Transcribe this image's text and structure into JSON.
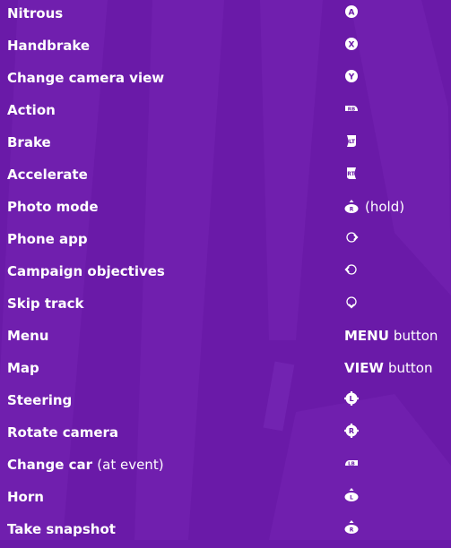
{
  "theme": {
    "background": "#6a1aa8",
    "text": "#ffffff",
    "icon_fill": "#ffffff",
    "icon_glyph": "#6a1aa8"
  },
  "controls": [
    {
      "action": "Nitrous",
      "icon": "a-button-icon",
      "glyph": "A"
    },
    {
      "action": "Handbrake",
      "icon": "x-button-icon",
      "glyph": "X"
    },
    {
      "action": "Change camera view",
      "icon": "y-button-icon",
      "glyph": "Y"
    },
    {
      "action": "Action",
      "icon": "rb-bumper-icon",
      "glyph": "RB"
    },
    {
      "action": "Brake",
      "icon": "lt-trigger-icon",
      "glyph": "LT"
    },
    {
      "action": "Accelerate",
      "icon": "rt-trigger-icon",
      "glyph": "RT"
    },
    {
      "action": "Photo mode",
      "icon": "right-stick-press-icon",
      "glyph": "R",
      "suffix": "(hold)"
    },
    {
      "action": "Phone app",
      "icon": "dpad-right-icon"
    },
    {
      "action": "Campaign objectives",
      "icon": "dpad-left-icon"
    },
    {
      "action": "Skip track",
      "icon": "dpad-down-icon"
    },
    {
      "action": "Menu",
      "button_word": "MENU",
      "button_rest": "button"
    },
    {
      "action": "Map",
      "button_word": "VIEW",
      "button_rest": "button"
    },
    {
      "action": "Steering",
      "icon": "left-stick-icon",
      "glyph": "L"
    },
    {
      "action": "Rotate camera",
      "icon": "right-stick-icon",
      "glyph": "R"
    },
    {
      "action": "Change car",
      "action_suffix": "(at event)",
      "icon": "lb-bumper-icon",
      "glyph": "LB"
    },
    {
      "action": "Horn",
      "icon": "left-stick-press-icon",
      "glyph": "L"
    },
    {
      "action": "Take snapshot",
      "icon": "right-stick-press-icon",
      "glyph": "R"
    }
  ]
}
